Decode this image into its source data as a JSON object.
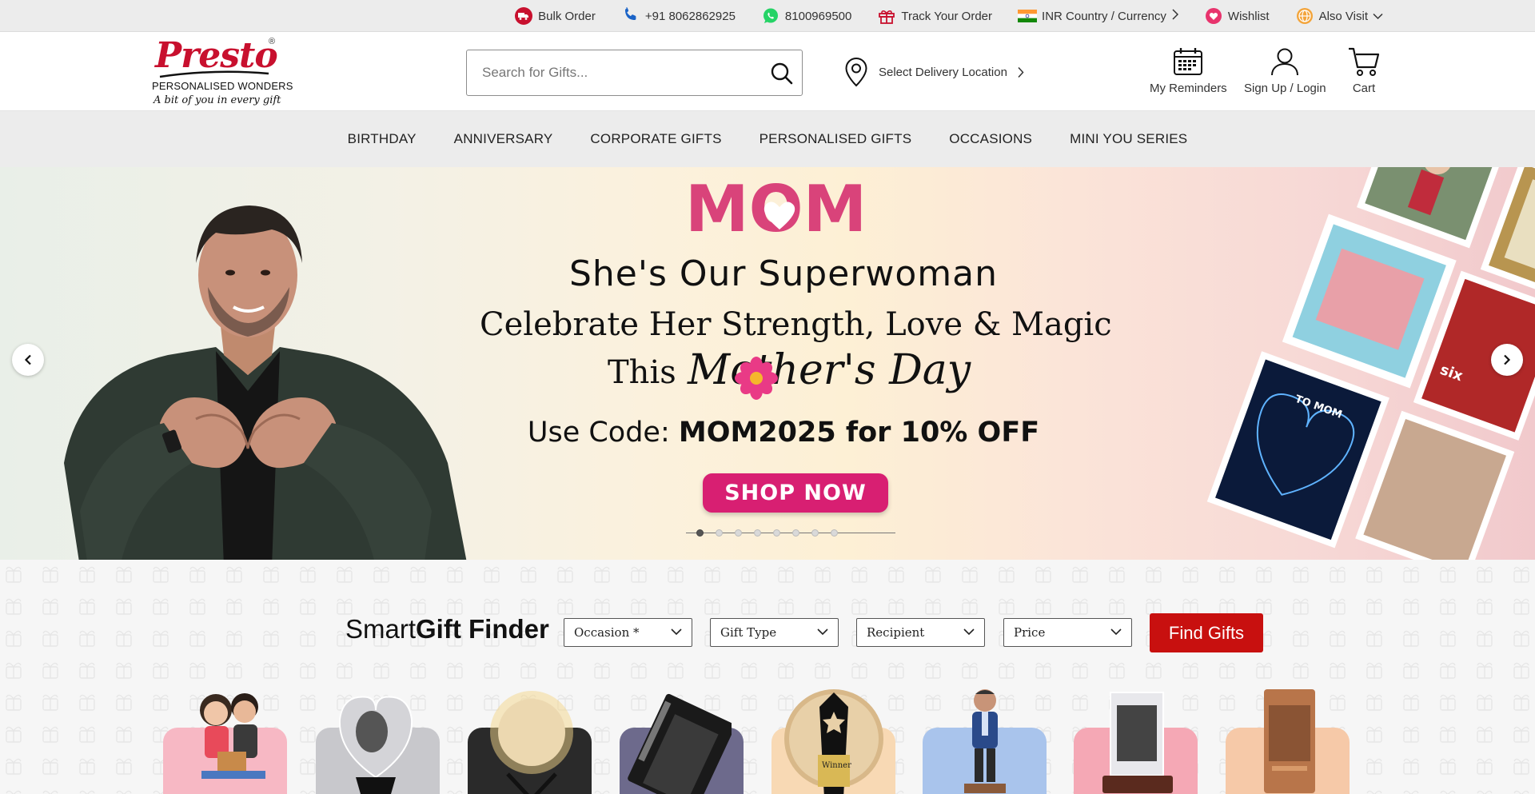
{
  "topbar": {
    "bulk_order": "Bulk Order",
    "phone": "+91 8062862925",
    "whatsapp": "8100969500",
    "track_order": "Track Your Order",
    "currency": "INR Country / Currency",
    "wishlist": "Wishlist",
    "also_visit": "Also Visit"
  },
  "header": {
    "logo_brand": "Presto",
    "logo_reg": "®",
    "logo_tagline": "PERSONALISED WONDERS",
    "logo_subtagline": "A bit of you in every gift",
    "search_placeholder": "Search for Gifts...",
    "delivery_label": "Select Delivery Location",
    "reminders_label": "My Reminders",
    "signin_label": "Sign Up / Login",
    "cart_label": "Cart"
  },
  "nav": {
    "items": [
      {
        "label": "BIRTHDAY"
      },
      {
        "label": "ANNIVERSARY"
      },
      {
        "label": "CORPORATE GIFTS"
      },
      {
        "label": "PERSONALISED GIFTS"
      },
      {
        "label": "OCCASIONS"
      },
      {
        "label": "MINI YOU SERIES"
      }
    ]
  },
  "hero": {
    "mom_logo": "MOM",
    "line1": "She's Our Superwoman",
    "line2": "Celebrate Her Strength, Love & Magic",
    "line3_prefix": "This",
    "line3_script": "Mother's Day",
    "code_prefix": "Use Code: ",
    "code_bold": "MOM2025 for 10% OFF",
    "cta": "SHOP NOW",
    "slides_total": 8,
    "active_slide": 1,
    "collage_texts": {
      "to_mom": "TO MOM",
      "six": "six",
      "winner": "Winner"
    }
  },
  "finder": {
    "title_regular": "Smart",
    "title_bold": "Gift Finder",
    "occasion": "Occasion *",
    "gift_type": "Gift Type",
    "recipient": "Recipient",
    "price": "Price",
    "button": "Find Gifts"
  },
  "colors": {
    "brand_red": "#c8102e",
    "cta_pink": "#d81f72",
    "find_btn": "#c8100f",
    "topbar_bg": "#ececec"
  },
  "card_colors": [
    "#f7b8c4",
    "#c8c8cc",
    "#2a2a2a",
    "#6d6a8c",
    "#f8d9b4",
    "#a9c4ec",
    "#f5a8b5",
    "#f6c9a8"
  ]
}
